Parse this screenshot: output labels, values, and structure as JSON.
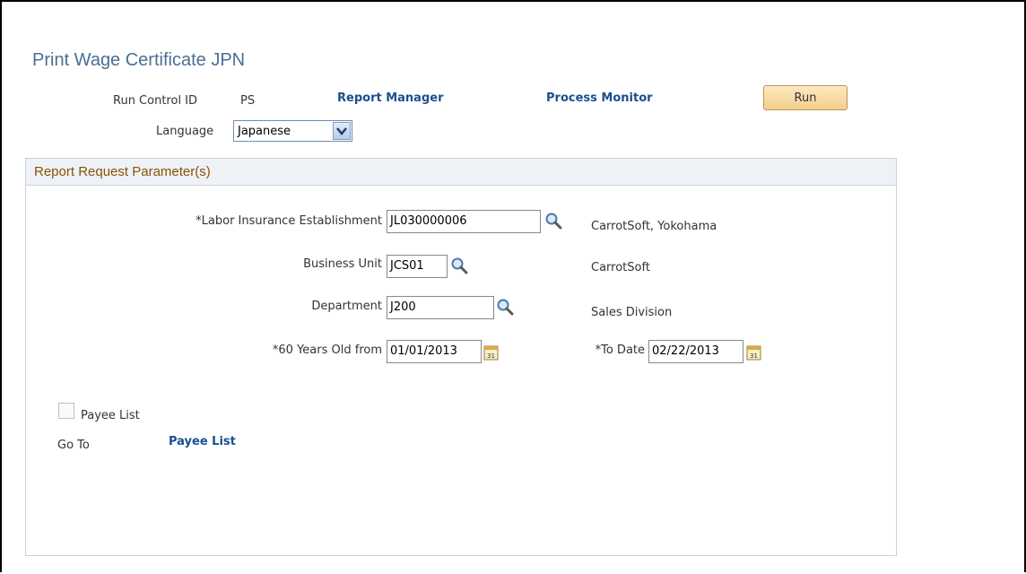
{
  "page": {
    "title": "Print Wage Certificate JPN"
  },
  "run_control": {
    "label": "Run Control ID",
    "value": "PS"
  },
  "links": {
    "report_manager": "Report Manager",
    "process_monitor": "Process Monitor"
  },
  "run_button": {
    "label": "Run"
  },
  "language": {
    "label": "Language",
    "value": "Japanese"
  },
  "panel": {
    "title": "Report Request Parameter(s)",
    "labor_insurance": {
      "label": "*Labor Insurance Establishment",
      "value": "JL030000006",
      "description": "CarrotSoft, Yokohama"
    },
    "business_unit": {
      "label": "Business Unit",
      "value": "JCS01",
      "description": "CarrotSoft"
    },
    "department": {
      "label": "Department",
      "value": "J200",
      "description": "Sales Division"
    },
    "from_date": {
      "label": "*60 Years Old from",
      "value": "01/01/2013"
    },
    "to_date": {
      "label": "*To Date",
      "value": "02/22/2013"
    },
    "payee_list_checkbox": {
      "label": "Payee List",
      "checked": false
    },
    "go_to": {
      "label": "Go To",
      "link": "Payee List"
    }
  },
  "icons": {
    "lookup": "magnifier-icon",
    "calendar": "calendar-icon",
    "dropdown": "chevron-down-icon"
  },
  "colors": {
    "title": "#4a6f94",
    "link": "#1b4f8f",
    "panel_title": "#8a5200",
    "button": "#f4cf8a"
  }
}
